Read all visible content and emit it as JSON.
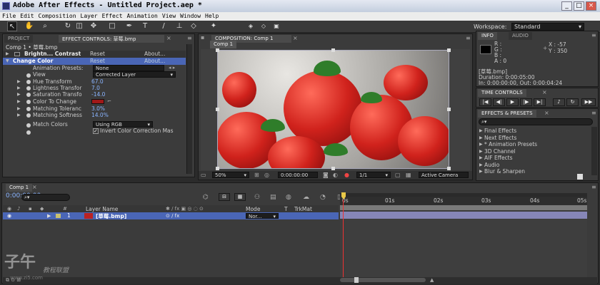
{
  "window": {
    "title": "Adobe After Effects - Untitled Project.aep *"
  },
  "menu": [
    "File",
    "Edit",
    "Composition",
    "Layer",
    "Effect",
    "Animation",
    "View",
    "Window",
    "Help"
  ],
  "workspace": {
    "label": "Workspace:",
    "value": "Standard"
  },
  "project_tab": "PROJECT",
  "effect_controls": {
    "tab": "EFFECT CONTROLS: 草莓.bmp",
    "breadcrumb": "Comp 1 • 草莓.bmp",
    "effects": [
      {
        "name": "Brightn... Contrast",
        "reset": "Reset",
        "about": "About..."
      },
      {
        "name": "Change Color",
        "reset": "Reset",
        "about": "About..."
      }
    ],
    "animation_presets": {
      "label": "Animation Presets:",
      "value": "None"
    },
    "view": {
      "label": "View",
      "value": "Corrected Layer"
    },
    "properties": [
      {
        "label": "Hue Transform",
        "value": "67.0"
      },
      {
        "label": "Lightness Transfor",
        "value": "7.0"
      },
      {
        "label": "Saturation Transfo",
        "value": "-14.0"
      },
      {
        "label": "Color To Change",
        "value": ""
      },
      {
        "label": "Matching Toleranc",
        "value": "3.0%"
      },
      {
        "label": "Matching Softness",
        "value": "14.0%"
      }
    ],
    "match_colors": {
      "label": "Match Colors",
      "value": "Using RGB"
    },
    "invert": {
      "label": "Invert Color Correction Mas"
    },
    "swatch_color": "#a01818"
  },
  "composition": {
    "tab": "COMPOSITION: Comp 1",
    "subtab": "Comp 1",
    "zoom": "50%",
    "timecode": "0:00:00:00",
    "resolution": "1/1",
    "camera": "Active Camera"
  },
  "info": {
    "tab": "INFO",
    "audio_tab": "AUDIO",
    "r": "R :",
    "g": "G :",
    "b": "B :",
    "a": "A : 0",
    "x": "X : -57",
    "y": "Y : 350",
    "name": "[草莓.bmp]",
    "duration": "Duration: 0:00:05:00",
    "inout": "In: 0:00:00:00, Out: 0:00:04:24"
  },
  "time_controls": {
    "tab": "TIME CONTROLS"
  },
  "effects_presets": {
    "tab": "EFFECTS & PRESETS",
    "items": [
      "Final Effects",
      "Next Effects",
      "* Animation Presets",
      "3D Channel",
      "AIF Effects",
      "Audio",
      "Blur & Sharpen"
    ]
  },
  "timeline": {
    "tab": "Comp 1",
    "timecode": "0:00:00:00",
    "headers": {
      "layer_name": "Layer Name",
      "mode": "Mode",
      "t": "T",
      "trkmat": "TrkMat"
    },
    "layer": {
      "num": "1",
      "name": "[草莓.bmp]",
      "mode": "Nor..."
    },
    "ruler": [
      "0s",
      "01s",
      "02s",
      "03s",
      "04s",
      "05s"
    ]
  },
  "watermark": {
    "text": "子午",
    "sub": "教程联盟",
    "url": "www.zi5.com"
  },
  "colors": {
    "titlebar": "#c4cede",
    "panel": "#3b3b3b",
    "accent_blue": "#8ab4ff",
    "selection": "#4a66b6"
  }
}
